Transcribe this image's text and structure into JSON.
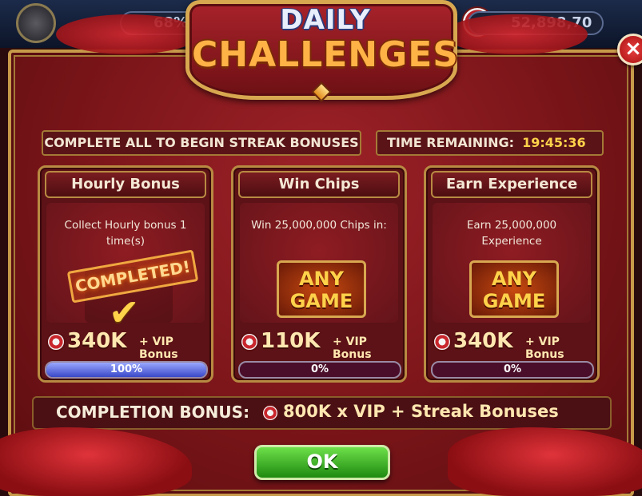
{
  "topbar": {
    "left_value": "68%",
    "right_value": "52,898,70"
  },
  "title": {
    "line1": "DAILY",
    "line2": "CHALLENGES"
  },
  "close_label": "×",
  "header": {
    "instruction": "COMPLETE ALL TO BEGIN STREAK BONUSES",
    "time_label": "TIME REMAINING:",
    "time_value": "19:45:36"
  },
  "cards": [
    {
      "title": "Hourly Bonus",
      "description": "Collect Hourly bonus 1 time(s)",
      "stamp": "COMPLETED!",
      "reward": "340K",
      "vip": "+ VIP Bonus",
      "progress_text": "100%",
      "progress_fraction": 1.0
    },
    {
      "title": "Win Chips",
      "description": "Win 25,000,000 Chips in:",
      "badge_line1": "ANY",
      "badge_line2": "GAME",
      "reward": "110K",
      "vip": "+ VIP Bonus",
      "progress_text": "0%",
      "progress_fraction": 0
    },
    {
      "title": "Earn Experience",
      "description": "Earn 25,000,000 Experience",
      "badge_line1": "ANY",
      "badge_line2": "GAME",
      "reward": "340K",
      "vip": "+ VIP Bonus",
      "progress_text": "0%",
      "progress_fraction": 0
    }
  ],
  "completion": {
    "label": "COMPLETION BONUS:",
    "value": "800K x VIP + Streak Bonuses"
  },
  "ok_label": "OK",
  "colors": {
    "panel_red": "#7a1519",
    "gold_border": "#c79a4a",
    "progress_blue": "#3a48c8",
    "ok_green": "#1e8a10",
    "time_yellow": "#ffd24a"
  }
}
